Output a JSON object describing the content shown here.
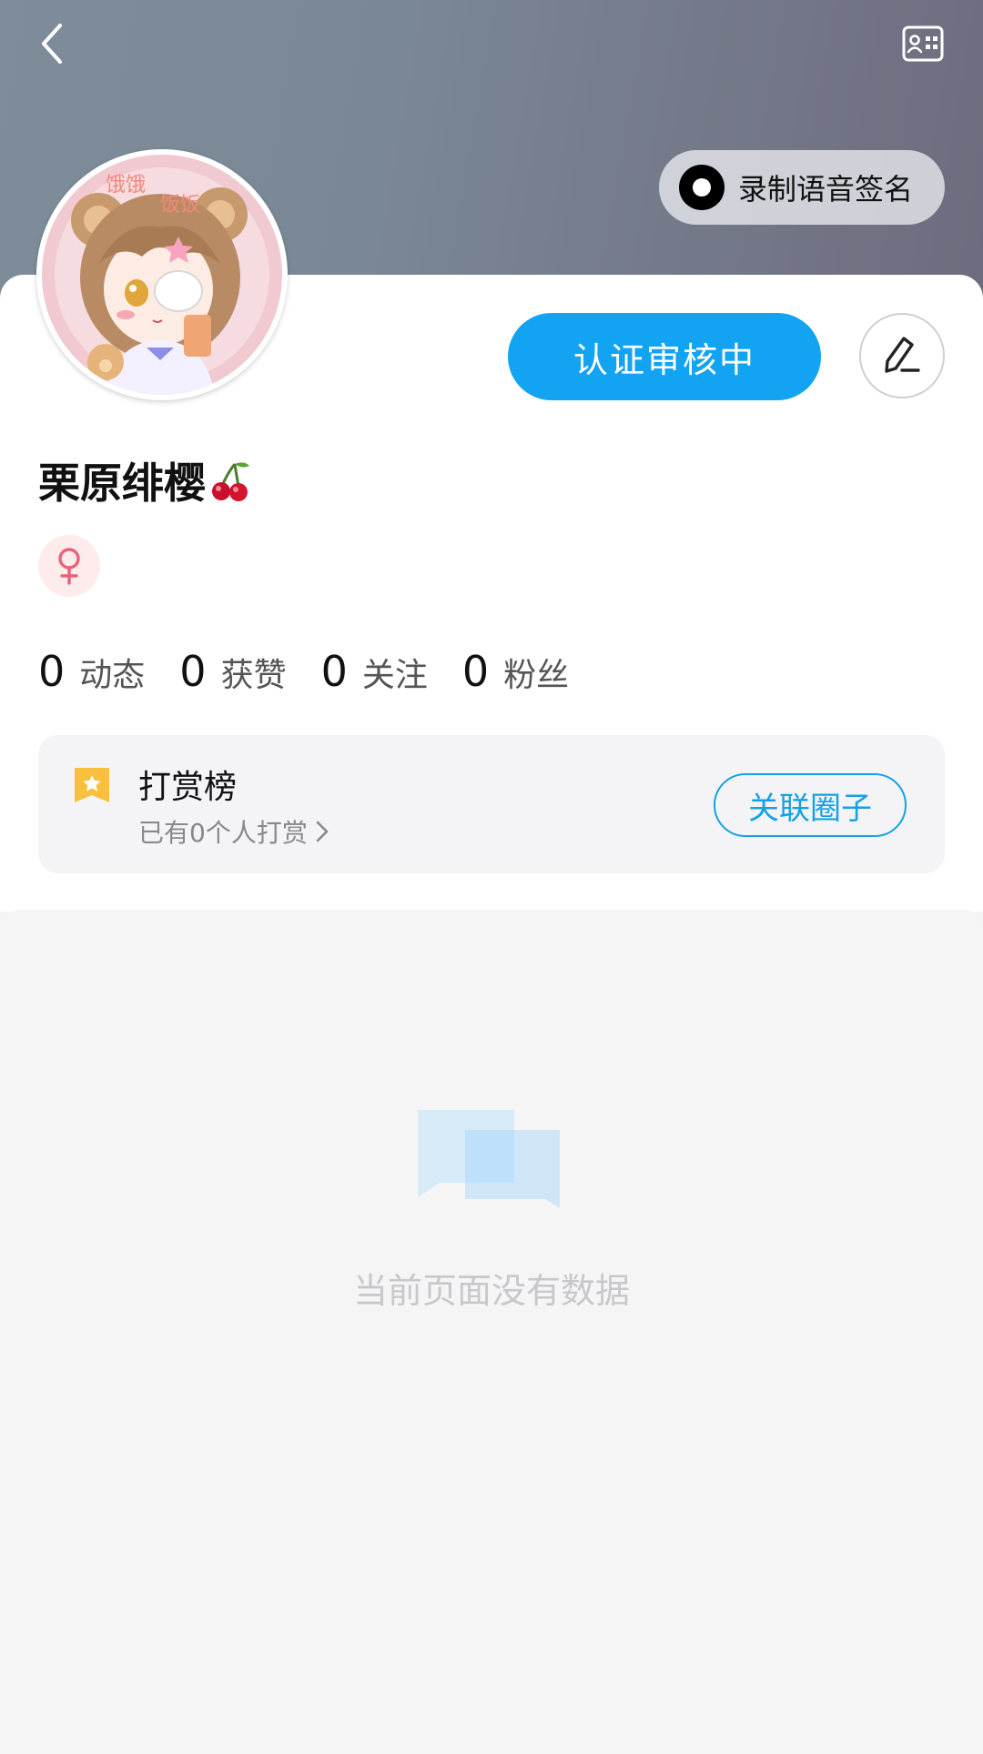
{
  "profile": {
    "record_voice_label": "录制语音签名",
    "verify_status_label": "认证审核中",
    "username": "栗原绯樱"
  },
  "stats": [
    {
      "value": "0",
      "label": "动态"
    },
    {
      "value": "0",
      "label": "获赞"
    },
    {
      "value": "0",
      "label": "关注"
    },
    {
      "value": "0",
      "label": "粉丝"
    }
  ],
  "reward": {
    "title": "打赏榜",
    "subtitle": "已有0个人打赏",
    "link_button": "关联圈子"
  },
  "empty_state": {
    "message": "当前页面没有数据"
  },
  "colors": {
    "primary_blue": "#12a3f2",
    "link_blue": "#14a1e6",
    "female_pink": "#e8637a",
    "reward_gold": "#f7c13d"
  },
  "icons": {
    "back": "chevron-left-icon",
    "card": "business-card-icon",
    "edit": "pencil-icon",
    "gender": "female-icon",
    "reward": "reward-ribbon-icon",
    "empty": "chat-bubbles-icon"
  }
}
